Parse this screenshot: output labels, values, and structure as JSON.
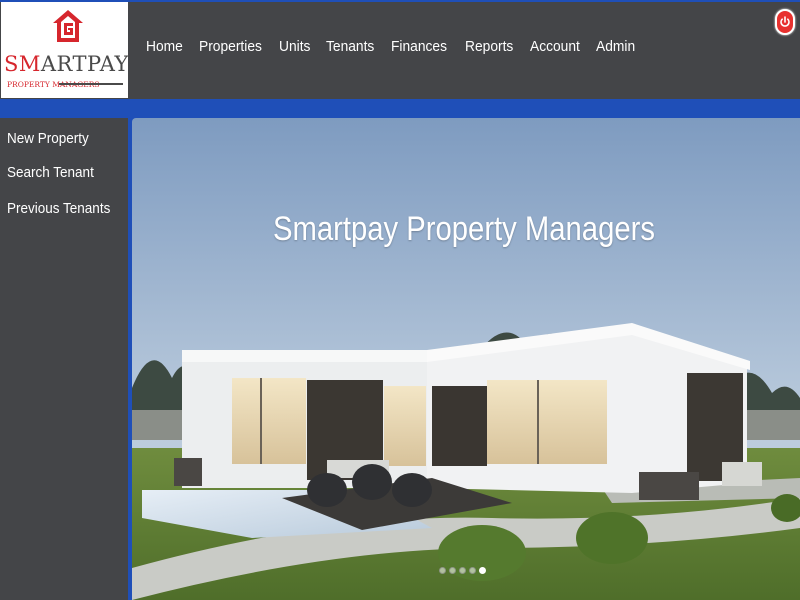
{
  "brand": {
    "name_red": "SM",
    "name_rest": "ARTPAY",
    "tagline": "PROPERTY MANAGERS",
    "accent_color": "#d6262d",
    "header_color": "#444548",
    "frame_color": "#1f4fb8"
  },
  "nav": {
    "items": [
      {
        "label": "Home"
      },
      {
        "label": "Properties"
      },
      {
        "label": "Units"
      },
      {
        "label": "Tenants"
      },
      {
        "label": "Finances"
      },
      {
        "label": "Reports"
      },
      {
        "label": "Account"
      },
      {
        "label": "Admin"
      }
    ],
    "power_icon": "power-icon"
  },
  "sidebar": {
    "items": [
      {
        "label": "New Property"
      },
      {
        "label": "Search Tenant"
      },
      {
        "label": "Previous Tenants"
      }
    ]
  },
  "hero": {
    "title": "Smartpay Property Managers",
    "slide_count": 5,
    "active_slide": 5
  }
}
